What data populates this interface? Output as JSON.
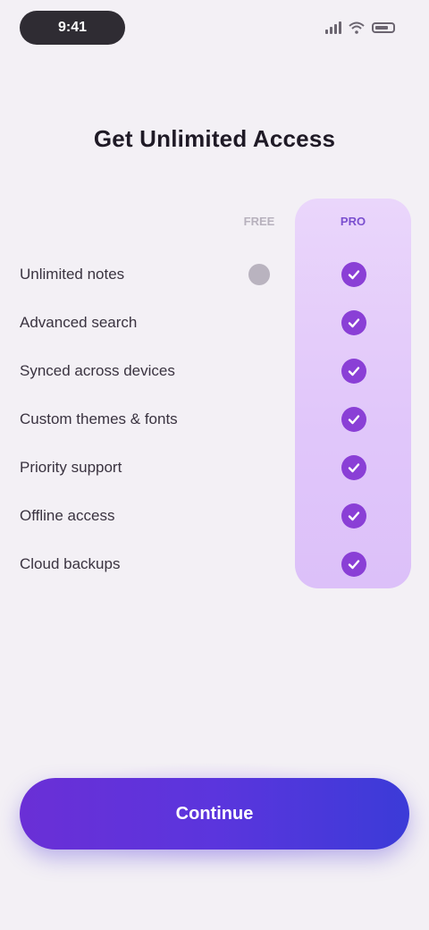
{
  "status_bar": {
    "time": "9:41"
  },
  "title": "Get Unlimited Access",
  "columns": {
    "free": "FREE",
    "pro": "PRO"
  },
  "features": [
    {
      "label": "Unlimited notes",
      "free": true,
      "pro": true
    },
    {
      "label": "Advanced search",
      "free": false,
      "pro": true
    },
    {
      "label": "Synced across devices",
      "free": false,
      "pro": true
    },
    {
      "label": "Custom themes & fonts",
      "free": false,
      "pro": true
    },
    {
      "label": "Priority support",
      "free": false,
      "pro": true
    },
    {
      "label": "Offline access",
      "free": false,
      "pro": true
    },
    {
      "label": "Cloud backups",
      "free": false,
      "pro": true
    }
  ],
  "cta": {
    "label": "Continue"
  },
  "colors": {
    "background": "#f3f0f5",
    "pro_column": "#e1c7fa",
    "check": "#8a3fd6",
    "cta_start": "#6a2fd6",
    "cta_end": "#3b3bd8"
  },
  "icons": {
    "check": "check-icon"
  }
}
